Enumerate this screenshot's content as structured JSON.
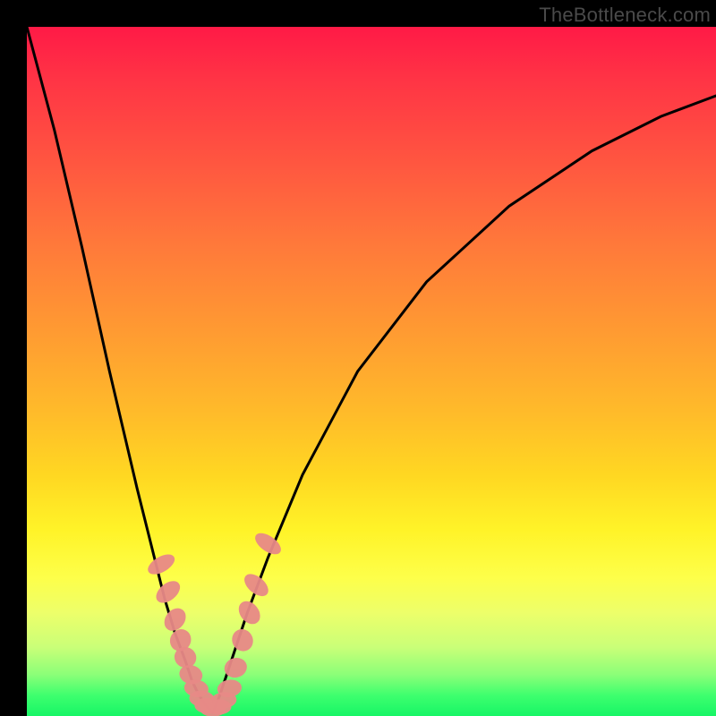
{
  "watermark": "TheBottleneck.com",
  "colors": {
    "gradient_top": "#ff1a46",
    "gradient_mid1": "#ff9a32",
    "gradient_mid2": "#fff328",
    "gradient_bottom": "#17f566",
    "curve": "#000000",
    "marker": "#e88a87",
    "background": "#000000"
  },
  "chart_data": {
    "type": "line",
    "title": "",
    "xlabel": "",
    "ylabel": "",
    "xlim": [
      0,
      100
    ],
    "ylim": [
      0,
      100
    ],
    "grid": false,
    "legend": false,
    "annotations": [
      "TheBottleneck.com"
    ],
    "series": [
      {
        "name": "left-branch",
        "x": [
          0,
          4,
          8,
          12,
          16,
          18,
          20,
          21.5,
          23,
          24,
          25,
          26,
          27
        ],
        "y": [
          100,
          85,
          68,
          50,
          33,
          25,
          17,
          12,
          8,
          5,
          3,
          1.5,
          0.5
        ]
      },
      {
        "name": "right-branch",
        "x": [
          27,
          28,
          29,
          30,
          32,
          35,
          40,
          48,
          58,
          70,
          82,
          92,
          100
        ],
        "y": [
          0.5,
          3,
          6,
          9,
          15,
          23,
          35,
          50,
          63,
          74,
          82,
          87,
          90
        ]
      }
    ],
    "markers": {
      "name": "cluster-points",
      "comment": "pink blob markers clustered near valley; y is bottleneck % (low = green)",
      "points": [
        {
          "x": 19.5,
          "y": 22
        },
        {
          "x": 20.5,
          "y": 18
        },
        {
          "x": 21.5,
          "y": 14
        },
        {
          "x": 22.3,
          "y": 11
        },
        {
          "x": 23.0,
          "y": 8.5
        },
        {
          "x": 23.8,
          "y": 6
        },
        {
          "x": 24.6,
          "y": 4
        },
        {
          "x": 25.4,
          "y": 2.5
        },
        {
          "x": 26.2,
          "y": 1.5
        },
        {
          "x": 27.0,
          "y": 1
        },
        {
          "x": 27.8,
          "y": 1.3
        },
        {
          "x": 28.6,
          "y": 2.3
        },
        {
          "x": 29.4,
          "y": 4
        },
        {
          "x": 30.3,
          "y": 7
        },
        {
          "x": 31.3,
          "y": 11
        },
        {
          "x": 32.3,
          "y": 15
        },
        {
          "x": 33.3,
          "y": 19
        },
        {
          "x": 35.0,
          "y": 25
        }
      ]
    }
  }
}
